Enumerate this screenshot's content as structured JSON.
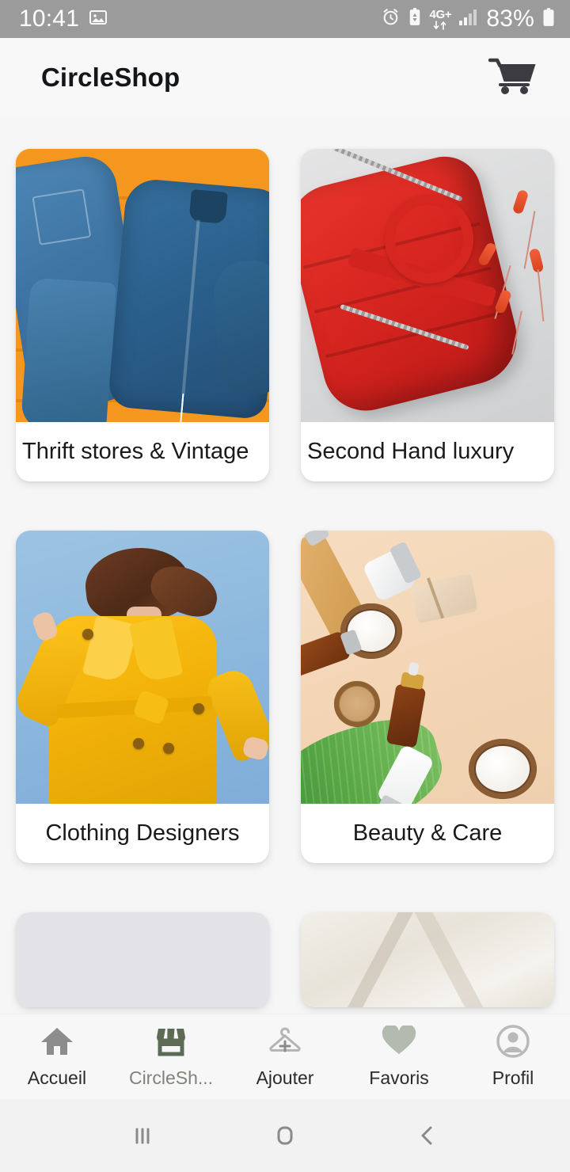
{
  "status_bar": {
    "time": "10:41",
    "battery_percent": "83%",
    "network_type": "4G+",
    "icons": [
      "image-icon",
      "alarm-icon",
      "battery-saver-icon",
      "network-4g-plus-icon",
      "signal-bars-icon",
      "battery-icon"
    ],
    "background_color": "#9b9b9b"
  },
  "header": {
    "title": "CircleShop",
    "cart_icon": "shopping-cart-icon"
  },
  "categories": [
    {
      "label": "Thrift stores & Vintage",
      "art": "denim",
      "align": "left"
    },
    {
      "label": "Second Hand luxury",
      "art": "bag",
      "align": "left"
    },
    {
      "label": "Clothing Designers",
      "art": "coat",
      "align": "center"
    },
    {
      "label": "Beauty & Care",
      "art": "beauty",
      "align": "center"
    }
  ],
  "bottom_nav": {
    "items": [
      {
        "label": "Accueil",
        "icon": "home-icon",
        "active": false
      },
      {
        "label": "CircleSh...",
        "icon": "store-icon",
        "active": true
      },
      {
        "label": "Ajouter",
        "icon": "hanger-plus-icon",
        "active": false
      },
      {
        "label": "Favoris",
        "icon": "heart-icon",
        "active": false
      },
      {
        "label": "Profil",
        "icon": "person-circle-icon",
        "active": false
      }
    ],
    "active_color": "#5d6b55",
    "inactive_color": "#8c8c8c"
  },
  "system_nav": {
    "recents": "recents-icon",
    "home": "home-square-icon",
    "back": "back-chevron-icon"
  }
}
